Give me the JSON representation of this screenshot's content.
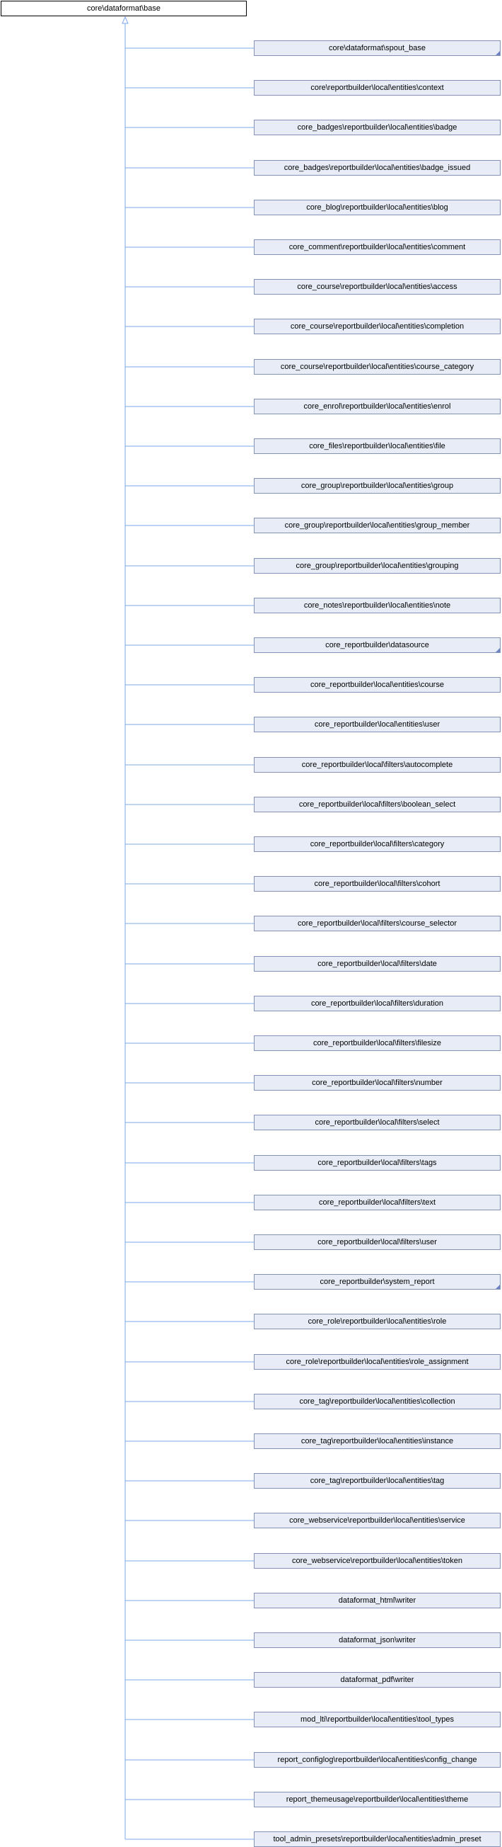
{
  "diagram": {
    "type": "class-inheritance",
    "root": {
      "label": "core\\dataformat\\base"
    },
    "colors": {
      "edge": "#7ea9ea",
      "node_fill": "#e8ecf6",
      "node_border": "#8592b5",
      "root_border": "#000000",
      "marker": "#6f82c2"
    },
    "children": [
      {
        "label": "core\\dataformat\\spout_base",
        "has_more": true
      },
      {
        "label": "core\\reportbuilder\\local\\entities\\context",
        "has_more": false
      },
      {
        "label": "core_badges\\reportbuilder\\local\\entities\\badge",
        "has_more": false
      },
      {
        "label": "core_badges\\reportbuilder\\local\\entities\\badge_issued",
        "has_more": false
      },
      {
        "label": "core_blog\\reportbuilder\\local\\entities\\blog",
        "has_more": false
      },
      {
        "label": "core_comment\\reportbuilder\\local\\entities\\comment",
        "has_more": false
      },
      {
        "label": "core_course\\reportbuilder\\local\\entities\\access",
        "has_more": false
      },
      {
        "label": "core_course\\reportbuilder\\local\\entities\\completion",
        "has_more": false
      },
      {
        "label": "core_course\\reportbuilder\\local\\entities\\course_category",
        "has_more": false
      },
      {
        "label": "core_enrol\\reportbuilder\\local\\entities\\enrol",
        "has_more": false
      },
      {
        "label": "core_files\\reportbuilder\\local\\entities\\file",
        "has_more": false
      },
      {
        "label": "core_group\\reportbuilder\\local\\entities\\group",
        "has_more": false
      },
      {
        "label": "core_group\\reportbuilder\\local\\entities\\group_member",
        "has_more": false
      },
      {
        "label": "core_group\\reportbuilder\\local\\entities\\grouping",
        "has_more": false
      },
      {
        "label": "core_notes\\reportbuilder\\local\\entities\\note",
        "has_more": false
      },
      {
        "label": "core_reportbuilder\\datasource",
        "has_more": true
      },
      {
        "label": "core_reportbuilder\\local\\entities\\course",
        "has_more": false
      },
      {
        "label": "core_reportbuilder\\local\\entities\\user",
        "has_more": false
      },
      {
        "label": "core_reportbuilder\\local\\filters\\autocomplete",
        "has_more": false
      },
      {
        "label": "core_reportbuilder\\local\\filters\\boolean_select",
        "has_more": false
      },
      {
        "label": "core_reportbuilder\\local\\filters\\category",
        "has_more": false
      },
      {
        "label": "core_reportbuilder\\local\\filters\\cohort",
        "has_more": false
      },
      {
        "label": "core_reportbuilder\\local\\filters\\course_selector",
        "has_more": false
      },
      {
        "label": "core_reportbuilder\\local\\filters\\date",
        "has_more": false
      },
      {
        "label": "core_reportbuilder\\local\\filters\\duration",
        "has_more": false
      },
      {
        "label": "core_reportbuilder\\local\\filters\\filesize",
        "has_more": false
      },
      {
        "label": "core_reportbuilder\\local\\filters\\number",
        "has_more": false
      },
      {
        "label": "core_reportbuilder\\local\\filters\\select",
        "has_more": false
      },
      {
        "label": "core_reportbuilder\\local\\filters\\tags",
        "has_more": false
      },
      {
        "label": "core_reportbuilder\\local\\filters\\text",
        "has_more": false
      },
      {
        "label": "core_reportbuilder\\local\\filters\\user",
        "has_more": false
      },
      {
        "label": "core_reportbuilder\\system_report",
        "has_more": true
      },
      {
        "label": "core_role\\reportbuilder\\local\\entities\\role",
        "has_more": false
      },
      {
        "label": "core_role\\reportbuilder\\local\\entities\\role_assignment",
        "has_more": false
      },
      {
        "label": "core_tag\\reportbuilder\\local\\entities\\collection",
        "has_more": false
      },
      {
        "label": "core_tag\\reportbuilder\\local\\entities\\instance",
        "has_more": false
      },
      {
        "label": "core_tag\\reportbuilder\\local\\entities\\tag",
        "has_more": false
      },
      {
        "label": "core_webservice\\reportbuilder\\local\\entities\\service",
        "has_more": false
      },
      {
        "label": "core_webservice\\reportbuilder\\local\\entities\\token",
        "has_more": false
      },
      {
        "label": "dataformat_html\\writer",
        "has_more": false
      },
      {
        "label": "dataformat_json\\writer",
        "has_more": false
      },
      {
        "label": "dataformat_pdf\\writer",
        "has_more": false
      },
      {
        "label": "mod_lti\\reportbuilder\\local\\entities\\tool_types",
        "has_more": false
      },
      {
        "label": "report_configlog\\reportbuilder\\local\\entities\\config_change",
        "has_more": false
      },
      {
        "label": "report_themeusage\\reportbuilder\\local\\entities\\theme",
        "has_more": false
      },
      {
        "label": "tool_admin_presets\\reportbuilder\\local\\entities\\admin_preset",
        "has_more": false
      }
    ]
  }
}
